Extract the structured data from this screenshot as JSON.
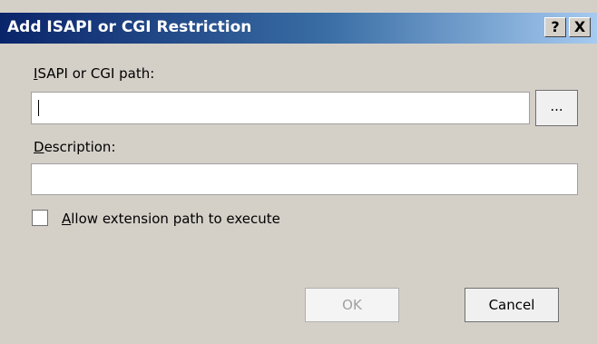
{
  "window": {
    "title": "Add ISAPI or CGI Restriction",
    "help_label": "?",
    "close_label": "X"
  },
  "form": {
    "path_label_accel": "I",
    "path_label_rest": "SAPI or CGI path:",
    "path_value": "",
    "browse_label": "...",
    "description_label_accel": "D",
    "description_label_rest": "escription:",
    "description_value": "",
    "allow_checkbox_checked": false,
    "allow_label_accel": "A",
    "allow_label_rest": "llow extension path to execute"
  },
  "buttons": {
    "ok_label": "OK",
    "ok_enabled": false,
    "cancel_label": "Cancel"
  }
}
